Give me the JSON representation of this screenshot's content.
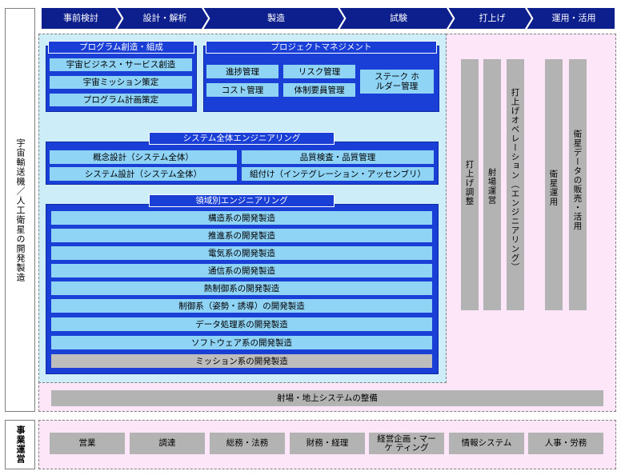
{
  "side": {
    "top_label": "宇宙輸送機／人工衛星の開発製造",
    "bottom_label": "事業運営"
  },
  "phases": [
    "事前検討",
    "設計・解析",
    "製造",
    "試験",
    "打上げ",
    "運用・活用"
  ],
  "program": {
    "title": "プログラム創造・組成",
    "items": [
      "宇宙ビジネス・サービス創造",
      "宇宙ミッション策定",
      "プログラム計画策定"
    ]
  },
  "project": {
    "title": "プロジェクトマネジメント",
    "items": [
      "進捗管理",
      "リスク管理",
      "コスト管理",
      "体制要員管理",
      "ステーク ホルダー管理"
    ]
  },
  "system": {
    "title": "システム全体エンジニアリング",
    "items": [
      "概念設計（システム全体）",
      "品質検査・品質管理",
      "システム設計（システム全体）",
      "組付け（インテグレーション・アッセンブリ）"
    ]
  },
  "domain": {
    "title": "領域別エンジニアリング",
    "items": [
      "構造系の開発製造",
      "推進系の開発製造",
      "電気系の開発製造",
      "通信系の開発製造",
      "熱制御系の開発製造",
      "制御系（姿勢・誘導）の開発製造",
      "データ処理系の開発製造",
      "ソフトウェア系の開発製造",
      "ミッション系の開発製造"
    ]
  },
  "operations": [
    "打上げ調整",
    "射場運営",
    "打上げオペレーション（エンジニアリング）",
    "衛星運用",
    "衛星データの販売・活用"
  ],
  "launch_site": "射場・地上システムの整備",
  "business": [
    "営業",
    "調達",
    "総務・法務",
    "財務・経理",
    "経営企画・マーケ ティング",
    "情報システム",
    "人事・労務"
  ],
  "colors": {
    "phase": "#0d1f8c",
    "group": "#1a3fd6",
    "cell": "#8fd3f5",
    "blue_zone": "#cdeef8",
    "pink_zone": "#fde6f7",
    "gray": "#b3b3b3"
  }
}
